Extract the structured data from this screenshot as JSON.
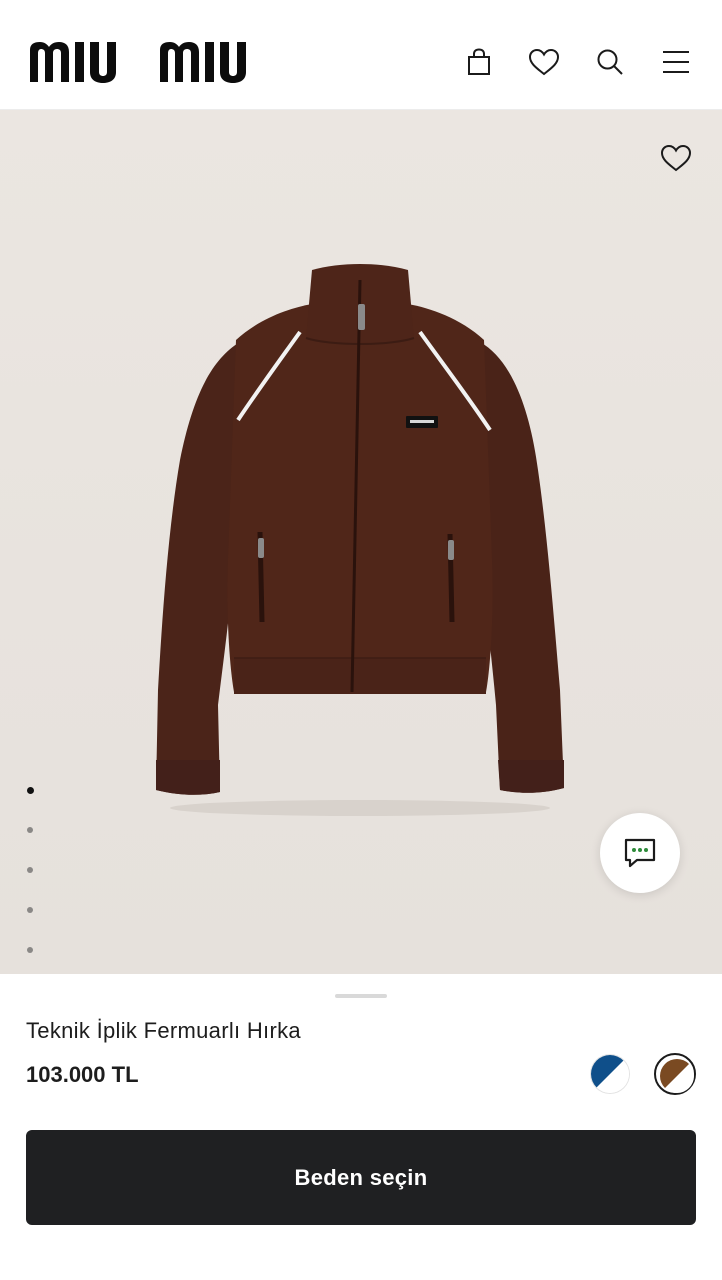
{
  "brand": {
    "logo_text": "miu miu"
  },
  "header": {
    "icons": [
      "bag-icon",
      "heart-icon",
      "search-icon",
      "menu-icon"
    ]
  },
  "gallery": {
    "image_count": 5,
    "active_index": 0
  },
  "product": {
    "name": "Teknik İplik Fermuarlı Hırka",
    "price": "103.000 TL",
    "colors": [
      {
        "primary": "#0f4f8a",
        "secondary": "#ffffff",
        "selected": false
      },
      {
        "primary": "#7a4a22",
        "secondary": "#ffffff",
        "selected": true
      }
    ]
  },
  "cta": {
    "label": "Beden seçin"
  },
  "colors": {
    "cta_bg": "#1f2022",
    "hero_bg": "#e8e3de",
    "jacket": "#4a2318"
  }
}
